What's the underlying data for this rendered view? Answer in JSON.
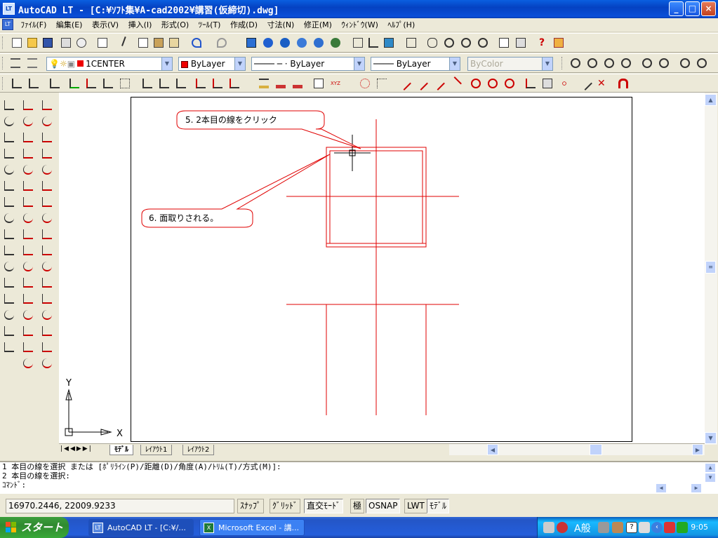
{
  "window": {
    "app_icon": "LT",
    "title": "AutoCAD LT - [C:¥ｿﾌﾄ集¥A-cad2002¥講習(仮締切).dwg]",
    "minimize": "_",
    "maximize": "□",
    "close": "×"
  },
  "menu": {
    "items": [
      "ﾌｧｲﾙ(F)",
      "編集(E)",
      "表示(V)",
      "挿入(I)",
      "形式(O)",
      "ﾂｰﾙ(T)",
      "作成(D)",
      "寸法(N)",
      "修正(M)",
      "ｳｨﾝﾄﾞｳ(W)",
      "ﾍﾙﾌﾟ(H)"
    ],
    "doc_min": "_",
    "doc_restore": "❐",
    "doc_close": "×"
  },
  "layers_toolbar": {
    "layer_name": "1CENTER",
    "layer_color": "#ff0000",
    "color_value": "ByLayer",
    "linetype_value": "ByLayer",
    "lineweight_value": "ByLayer",
    "plotstyle_value": "ByColor"
  },
  "drawing": {
    "callout1_text": "5. 2本目の線をクリック",
    "callout2_text": "6. 面取りされる。",
    "line_color": "#e00000",
    "ucs_x": "X",
    "ucs_y": "Y"
  },
  "layout_tabs": [
    "ﾓﾃﾞﾙ",
    "ﾚｲｱｳﾄ1",
    "ﾚｲｱｳﾄ2"
  ],
  "command": {
    "line1": "1 本目の線を選択 または [ﾎﾟﾘﾗｲﾝ(P)/距離(D)/角度(A)/ﾄﾘﾑ(T)/方式(M)]:",
    "line2": "2 本目の線を選択:",
    "prompt": "ｺﾏﾝﾄﾞ:"
  },
  "status": {
    "coordinates": "16970.2446, 22009.9233",
    "toggles": [
      "ｽﾅｯﾌﾟ",
      "ｸﾞﾘｯﾄﾞ",
      "直交ﾓｰﾄﾞ",
      "極",
      "OSNAP",
      "LWT",
      "ﾓﾃﾞﾙ"
    ]
  },
  "taskbar": {
    "start_label": "スタート",
    "task1_label": "AutoCAD LT - [C:¥/...",
    "task1_icon": "LT",
    "task2_label": "Microsoft Excel - 講...",
    "task2_icon": "X",
    "ime_label": "A般",
    "clock": "9:05"
  }
}
